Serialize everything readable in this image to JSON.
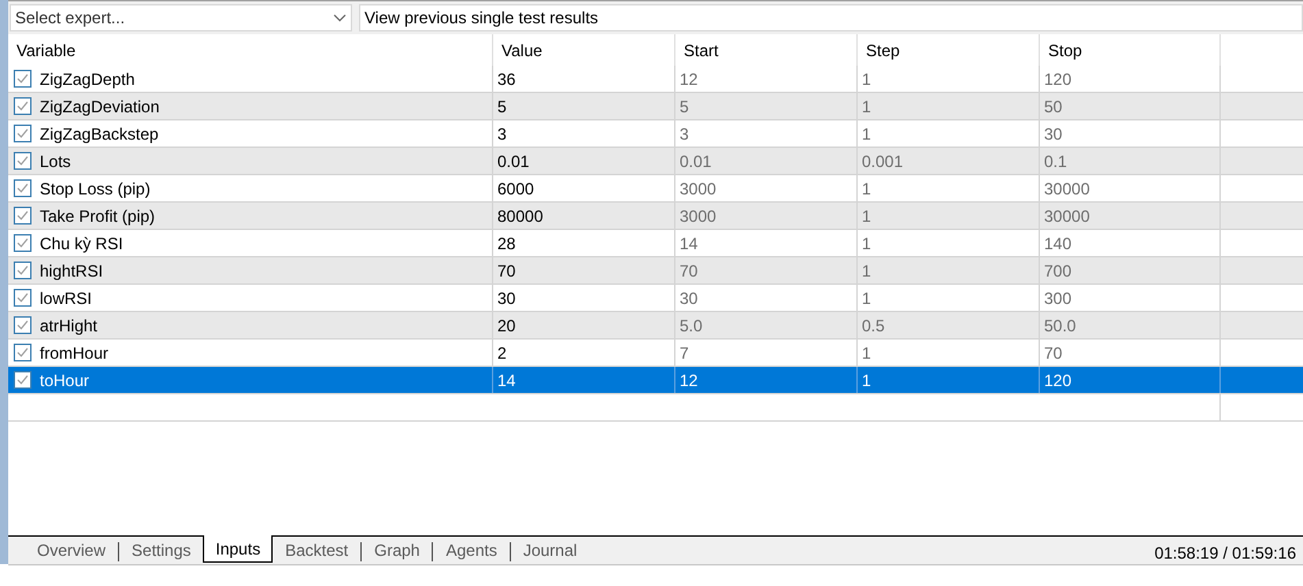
{
  "toolbar": {
    "expert_select": {
      "placeholder": "Select expert..."
    },
    "results_field": {
      "value": "View previous single test results"
    }
  },
  "table": {
    "columns": [
      "Variable",
      "Value",
      "Start",
      "Step",
      "Stop"
    ],
    "rows": [
      {
        "checked": true,
        "selected": false,
        "variable": "ZigZagDepth",
        "value": "36",
        "start": "12",
        "step": "1",
        "stop": "120"
      },
      {
        "checked": true,
        "selected": false,
        "variable": "ZigZagDeviation",
        "value": "5",
        "start": "5",
        "step": "1",
        "stop": "50"
      },
      {
        "checked": true,
        "selected": false,
        "variable": "ZigZagBackstep",
        "value": "3",
        "start": "3",
        "step": "1",
        "stop": "30"
      },
      {
        "checked": true,
        "selected": false,
        "variable": "Lots",
        "value": "0.01",
        "start": "0.01",
        "step": "0.001",
        "stop": "0.1"
      },
      {
        "checked": true,
        "selected": false,
        "variable": "Stop Loss (pip)",
        "value": "6000",
        "start": "3000",
        "step": "1",
        "stop": "30000"
      },
      {
        "checked": true,
        "selected": false,
        "variable": "Take Profit (pip)",
        "value": "80000",
        "start": "3000",
        "step": "1",
        "stop": "30000"
      },
      {
        "checked": true,
        "selected": false,
        "variable": "Chu kỳ RSI",
        "value": "28",
        "start": "14",
        "step": "1",
        "stop": "140"
      },
      {
        "checked": true,
        "selected": false,
        "variable": "hightRSI",
        "value": "70",
        "start": "70",
        "step": "1",
        "stop": "700"
      },
      {
        "checked": true,
        "selected": false,
        "variable": "lowRSI",
        "value": "30",
        "start": "30",
        "step": "1",
        "stop": "300"
      },
      {
        "checked": true,
        "selected": false,
        "variable": "atrHight",
        "value": "20",
        "start": "5.0",
        "step": "0.5",
        "stop": "50.0"
      },
      {
        "checked": true,
        "selected": false,
        "variable": "fromHour",
        "value": "2",
        "start": "7",
        "step": "1",
        "stop": "70"
      },
      {
        "checked": true,
        "selected": true,
        "variable": "toHour",
        "value": "14",
        "start": "12",
        "step": "1",
        "stop": "120"
      }
    ]
  },
  "tabs": [
    {
      "label": "Overview",
      "selected": false
    },
    {
      "label": "Settings",
      "selected": false
    },
    {
      "label": "Inputs",
      "selected": true
    },
    {
      "label": "Backtest",
      "selected": false
    },
    {
      "label": "Graph",
      "selected": false
    },
    {
      "label": "Agents",
      "selected": false
    },
    {
      "label": "Journal",
      "selected": false
    }
  ],
  "status": {
    "time": "01:58:19 / 01:59:16"
  }
}
